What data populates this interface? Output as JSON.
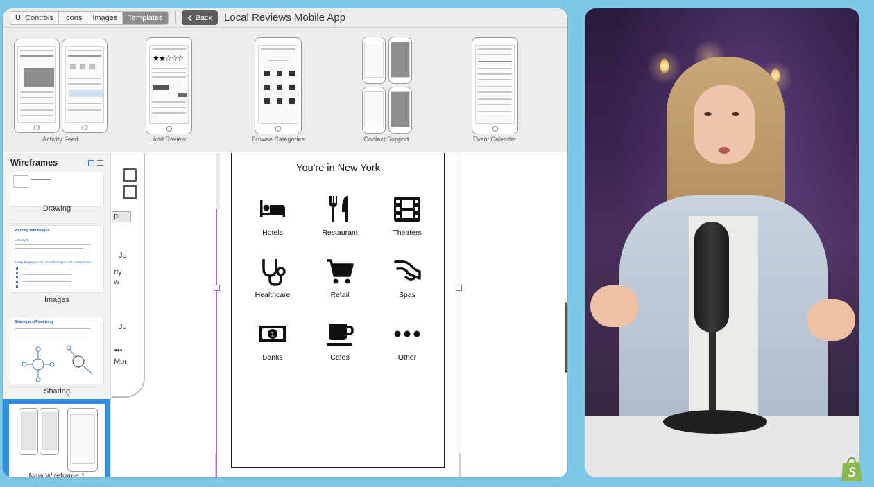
{
  "toolbar": {
    "tabs": [
      {
        "label": "UI Controls",
        "active": false
      },
      {
        "label": "Icons",
        "active": false
      },
      {
        "label": "Images",
        "active": false
      },
      {
        "label": "Templates",
        "active": true
      }
    ],
    "back_label": "Back",
    "project_title": "Local Reviews Mobile App"
  },
  "templates": {
    "items": [
      {
        "label": "Activity Feed"
      },
      {
        "label": "Add Review"
      },
      {
        "label": "Browse Categories"
      },
      {
        "label": "Contact Support"
      },
      {
        "label": "Event Calendar"
      }
    ]
  },
  "wireframes": {
    "heading": "Wireframes",
    "items": [
      {
        "label": "Drawing"
      },
      {
        "label": "Images"
      },
      {
        "label": "Sharing"
      },
      {
        "label": "New Wireframe 1"
      }
    ],
    "images_thumb_title": "Working with Images",
    "images_thumb_sub1": "Let's try it!",
    "images_thumb_sub2": "Funny things you can do with images and screenshots!",
    "sharing_thumb_title": "Sharing and Reviewing"
  },
  "canvas": {
    "prev_phone_text": {
      "ju1": "Ju",
      "rly": "rly",
      "w": "w",
      "ju2": "Ju",
      "dots": "•••",
      "mor": "Mor",
      "p": "p"
    },
    "screen_title": "You're in New York",
    "categories": [
      {
        "label": "Hotels",
        "icon": "bed-icon"
      },
      {
        "label": "Restaurant",
        "icon": "utensils-icon"
      },
      {
        "label": "Theaters",
        "icon": "film-icon"
      },
      {
        "label": "Healthcare",
        "icon": "stethoscope-icon"
      },
      {
        "label": "Retail",
        "icon": "cart-icon"
      },
      {
        "label": "Spas",
        "icon": "spa-icon"
      },
      {
        "label": "Banks",
        "icon": "money-icon"
      },
      {
        "label": "Cafes",
        "icon": "coffee-icon"
      },
      {
        "label": "Other",
        "icon": "more-icon"
      }
    ]
  },
  "colors": {
    "background": "#7cc8e6",
    "selection": "#b066c8",
    "selected_wireframe": "#2f8de4",
    "toolbar_active": "#8c8c8c"
  }
}
